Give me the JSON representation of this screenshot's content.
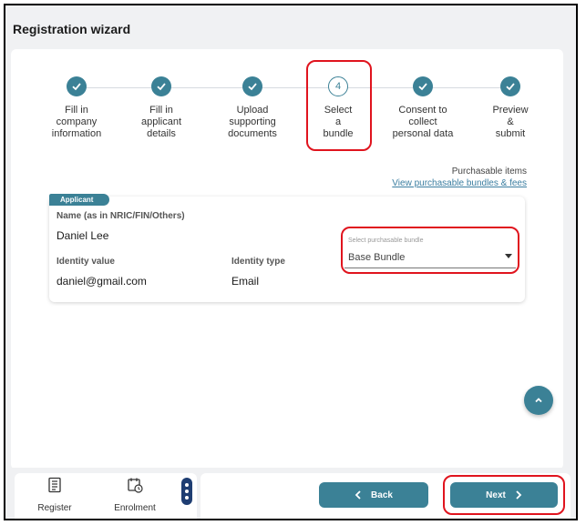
{
  "header": {
    "title": "Registration wizard"
  },
  "stepper": {
    "current_step": "4",
    "steps": [
      {
        "label": "Fill in\ncompany\ninformation",
        "state": "done"
      },
      {
        "label": "Fill in\napplicant\ndetails",
        "state": "done"
      },
      {
        "label": "Upload\nsupporting\ndocuments",
        "state": "done"
      },
      {
        "label": "Select\na\nbundle",
        "state": "current"
      },
      {
        "label": "Consent to\ncollect\npersonal data",
        "state": "done"
      },
      {
        "label": "Preview\n&\nsubmit",
        "state": "done"
      }
    ]
  },
  "purchasable": {
    "title": "Purchasable items",
    "link": "View purchasable bundles & fees"
  },
  "applicant": {
    "tag": "Applicant",
    "name_label": "Name (as in NRIC/FIN/Others)",
    "name_value": "Daniel Lee",
    "id_value_label": "Identity value",
    "id_value": "daniel@gmail.com",
    "id_type_label": "Identity type",
    "id_type": "Email",
    "bundle_select": {
      "placeholder": "Select purchasable bundle",
      "value": "Base Bundle"
    }
  },
  "bottom_nav": {
    "items": [
      {
        "label": "Register",
        "icon": "register-icon"
      },
      {
        "label": "Enrolment",
        "icon": "enrolment-icon"
      }
    ]
  },
  "actions": {
    "back_label": "Back",
    "next_label": "Next"
  },
  "colors": {
    "accent": "#3b8196",
    "highlight": "#e0141e",
    "more_menu": "#1e3d72"
  }
}
